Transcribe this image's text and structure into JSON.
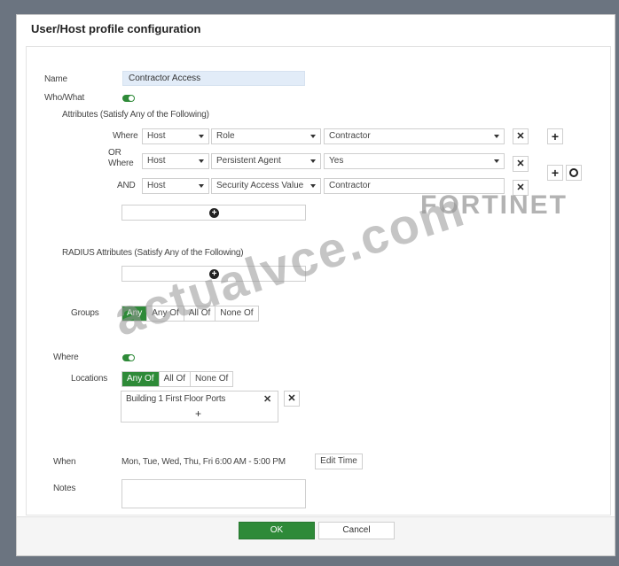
{
  "dialog": {
    "title": "User/Host profile configuration"
  },
  "name": {
    "label": "Name",
    "value": "Contractor Access"
  },
  "who_what": {
    "label": "Who/What"
  },
  "attributes": {
    "label": "Attributes (Satisfy Any of the Following)",
    "where_label": "Where",
    "or_label": "OR",
    "or_where_label": "Where",
    "and_label": "AND",
    "row1": {
      "object": "Host",
      "attribute": "Role",
      "value": "Contractor"
    },
    "row2": {
      "object": "Host",
      "attribute": "Persistent Agent",
      "value": "Yes"
    },
    "row3": {
      "object": "Host",
      "attribute": "Security Access Value",
      "value": "Contractor"
    }
  },
  "radius": {
    "label": "RADIUS Attributes (Satisfy Any of the Following)"
  },
  "groups": {
    "label": "Groups",
    "options": [
      "Any",
      "Any Of",
      "All Of",
      "None Of"
    ],
    "selected": "Any"
  },
  "where": {
    "label": "Where"
  },
  "locations": {
    "label": "Locations",
    "options": [
      "Any Of",
      "All Of",
      "None Of"
    ],
    "selected": "Any Of",
    "items": [
      "Building 1 First Floor Ports"
    ]
  },
  "when": {
    "label": "When",
    "value": "Mon, Tue, Wed, Thu, Fri 6:00 AM - 5:00 PM",
    "edit_button": "Edit Time"
  },
  "notes": {
    "label": "Notes",
    "value": ""
  },
  "icons": {
    "close_glyph": "✕",
    "plus_glyph": "+",
    "add_circle": "add-circle-icon",
    "gear": "gear-icon"
  },
  "footer": {
    "ok": "OK",
    "cancel": "Cancel"
  },
  "watermarks": {
    "brand": "FORTINET",
    "site": "actualvce.com"
  },
  "colors": {
    "accent": "#2e8a38",
    "name_field_bg": "#e2ecf8",
    "backdrop": "#6b7480"
  }
}
